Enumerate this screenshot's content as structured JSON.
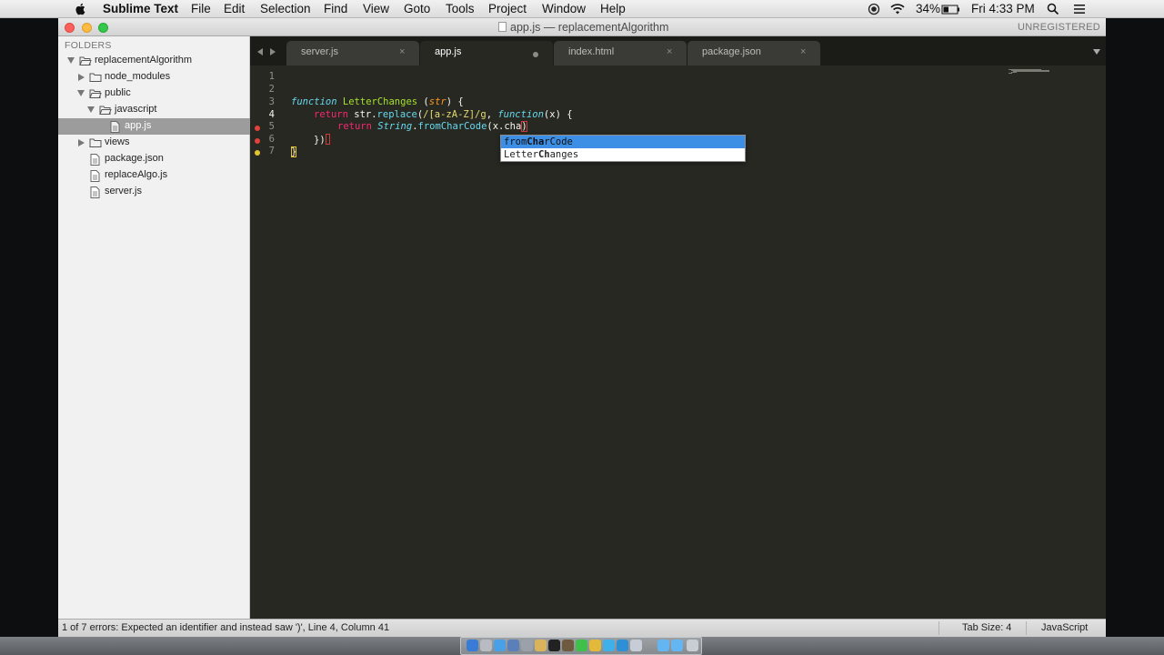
{
  "menubar": {
    "app_name": "Sublime Text",
    "menus": [
      "File",
      "Edit",
      "Selection",
      "Find",
      "View",
      "Goto",
      "Tools",
      "Project",
      "Window",
      "Help"
    ],
    "battery": "34%",
    "clock": "Fri 4:33 PM"
  },
  "window": {
    "title": "app.js — replacementAlgorithm",
    "unregistered": "UNREGISTERED"
  },
  "sidebar": {
    "header": "FOLDERS",
    "items": [
      {
        "label": "replacementAlgorithm",
        "type": "folder",
        "expanded": true
      },
      {
        "label": "node_modules",
        "type": "folder",
        "expanded": false
      },
      {
        "label": "public",
        "type": "folder",
        "expanded": true
      },
      {
        "label": "javascript",
        "type": "folder",
        "expanded": true
      },
      {
        "label": "app.js",
        "type": "file",
        "selected": true
      },
      {
        "label": "views",
        "type": "folder",
        "expanded": false
      },
      {
        "label": "package.json",
        "type": "file"
      },
      {
        "label": "replaceAlgo.js",
        "type": "file"
      },
      {
        "label": "server.js",
        "type": "file"
      }
    ]
  },
  "tabs": [
    {
      "label": "server.js",
      "active": false,
      "close": "×"
    },
    {
      "label": "app.js",
      "active": true,
      "dirty": true
    },
    {
      "label": "index.html",
      "active": false,
      "close": "×"
    },
    {
      "label": "package.json",
      "active": false,
      "close": "×"
    }
  ],
  "editor": {
    "line_numbers": [
      "1",
      "2",
      "3",
      "4",
      "5",
      "6",
      "7"
    ],
    "current_line": 4,
    "gutter_markers": {
      "4": "error",
      "5": "error",
      "6": "warning"
    },
    "code": {
      "l2": {
        "kw_function": "function",
        "name": "LetterChanges",
        "open": " (",
        "param": "str",
        "close": ") {"
      },
      "l3": {
        "kw_return": "return",
        "pre": " str.",
        "method": "replace",
        "paren": "(",
        "regex": "/[a-zA-Z]/g",
        "comma": ", ",
        "kw_function": "function",
        "args": "(x) {"
      },
      "l4": {
        "kw_return": "return",
        "sp": " ",
        "type": "String",
        "dot": ".",
        "method": "fromCharCode",
        "rest": "(x.cha",
        "close": ")"
      },
      "l5": {
        "text": "})"
      },
      "l6": {
        "text": "}"
      }
    },
    "autocomplete": [
      {
        "pre": "from",
        "match": "Cha",
        "post": "rCode",
        "selected": true
      },
      {
        "pre": "Letter",
        "match": "Ch",
        "post": "anges",
        "selected": false
      }
    ]
  },
  "statusbar": {
    "message": "1 of 7 errors: Expected an identifier and instead saw ')', Line 4, Column 41",
    "tab_size": "Tab Size: 4",
    "syntax": "JavaScript"
  },
  "colors": {
    "editor_bg": "#272822",
    "keyword": "#f92672",
    "storage": "#66d9ef",
    "function_name": "#a6e22e",
    "parameter": "#fd971f",
    "regex": "#e6db74",
    "selection": "#3d8ee5"
  }
}
